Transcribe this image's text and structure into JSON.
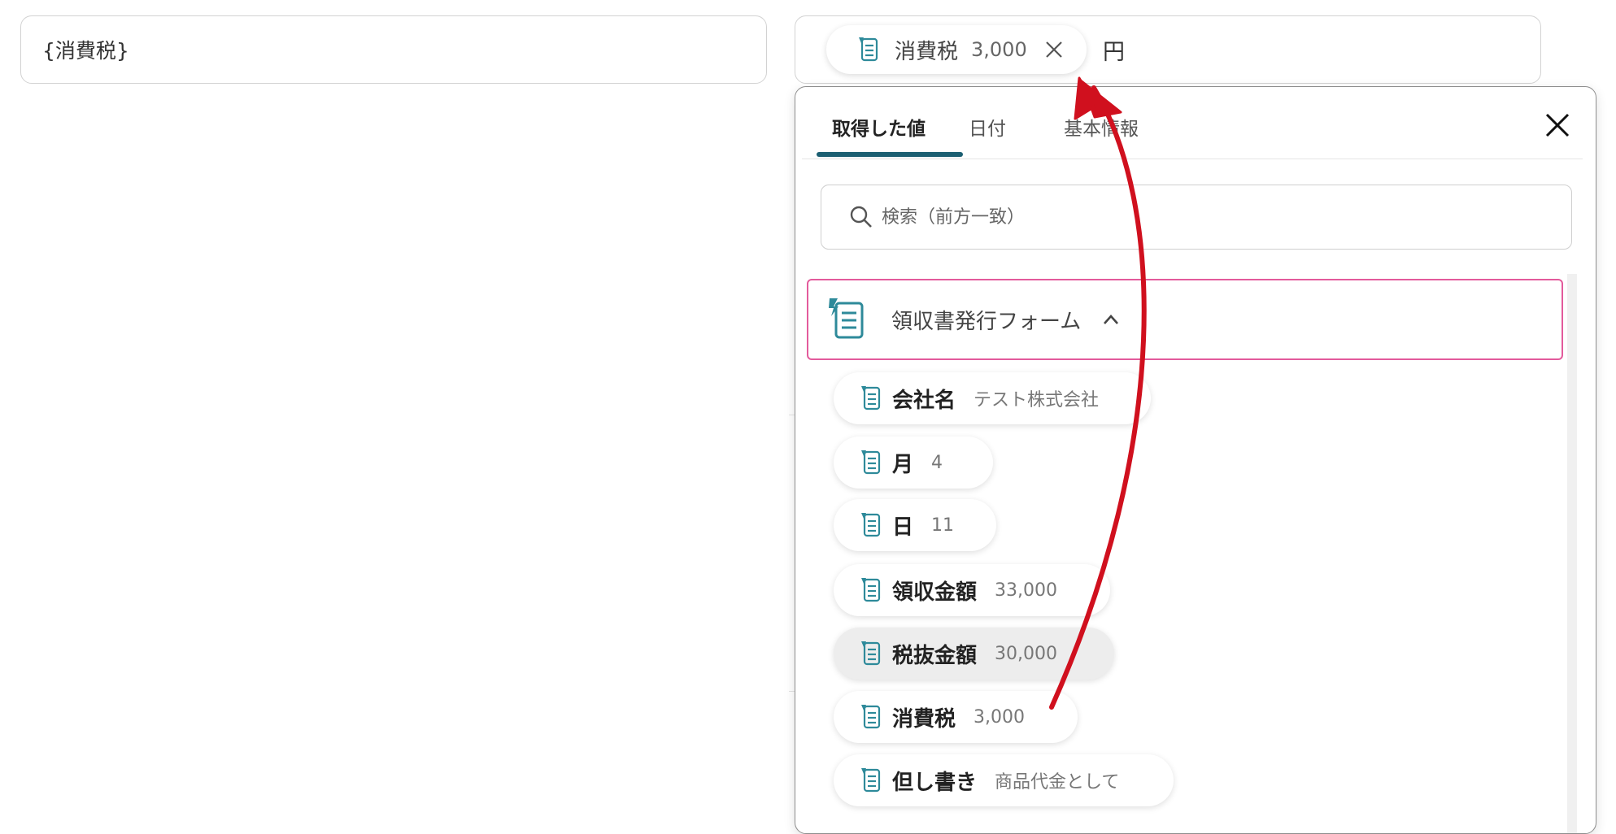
{
  "left_field": {
    "value": "{消費税}"
  },
  "right_field": {
    "chip": {
      "label": "消費税",
      "value": "3,000"
    },
    "unit": "円"
  },
  "panel": {
    "tabs": [
      {
        "label": "取得した値",
        "active": true
      },
      {
        "label": "日付",
        "active": false
      },
      {
        "label": "基本情報",
        "active": false
      }
    ],
    "search": {
      "placeholder": "検索（前方一致）"
    },
    "group": {
      "title": "領収書発行フォーム",
      "expanded": true,
      "items": [
        {
          "label": "会社名",
          "value": "テスト株式会社"
        },
        {
          "label": "月",
          "value": "4"
        },
        {
          "label": "日",
          "value": "11"
        },
        {
          "label": "領収金額",
          "value": "33,000"
        },
        {
          "label": "税抜金額",
          "value": "30,000"
        },
        {
          "label": "消費税",
          "value": "3,000"
        },
        {
          "label": "但し書き",
          "value": "商品代金として"
        }
      ]
    }
  },
  "colors": {
    "accent_tab": "#1c5f72",
    "group_border": "#e35b9c",
    "arrow": "#d0101e",
    "icon_teal": "#2e8a9a"
  },
  "icons": [
    "form-field-icon",
    "close-icon",
    "search-icon",
    "chevron-up-icon"
  ]
}
